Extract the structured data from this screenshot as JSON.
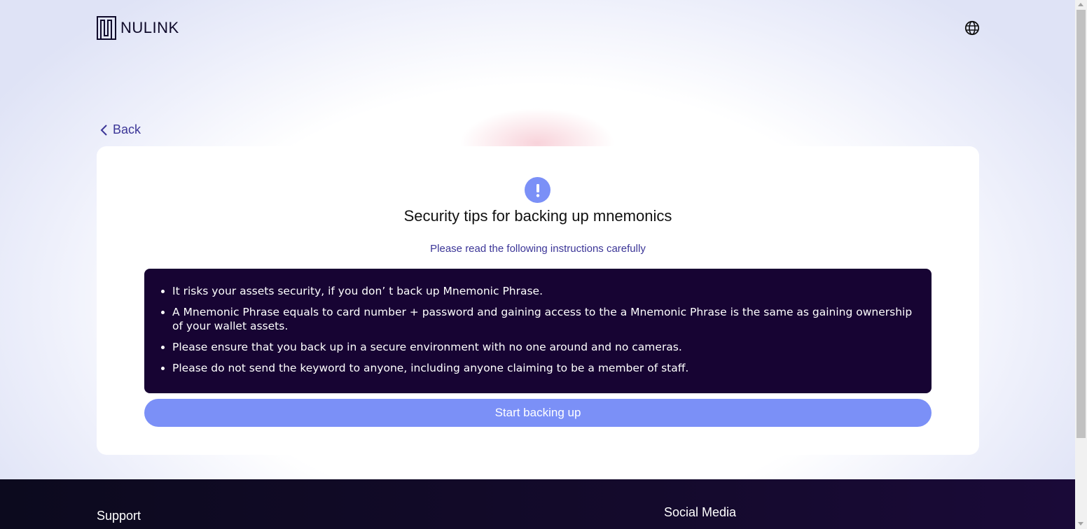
{
  "header": {
    "logo_text": "NULINK",
    "language_icon": "globe-icon"
  },
  "nav": {
    "back_label": "Back",
    "back_icon": "chevron-left-icon"
  },
  "card": {
    "icon": "exclamation-icon",
    "title": "Security tips for backing up mnemonics",
    "subtitle": "Please read the following instructions carefully",
    "tips": [
      "It risks your assets security, if you don’ t back up Mnemonic Phrase.",
      "A Mnemonic Phrase equals to card number + password and gaining access to the a Mnemonic Phrase is the same as gaining ownership of your wallet assets.",
      "Please ensure that you back up in a secure environment with no one around and no cameras.",
      "Please do not send the keyword to anyone, including anyone claiming to be a member of staff."
    ],
    "start_button_label": "Start backing up"
  },
  "footer": {
    "support_title": "Support",
    "social_title": "Social Media"
  },
  "colors": {
    "accent": "#7b90f7",
    "link": "#3b3597",
    "tips_background": "#170433",
    "footer_background": "#140a2c"
  }
}
